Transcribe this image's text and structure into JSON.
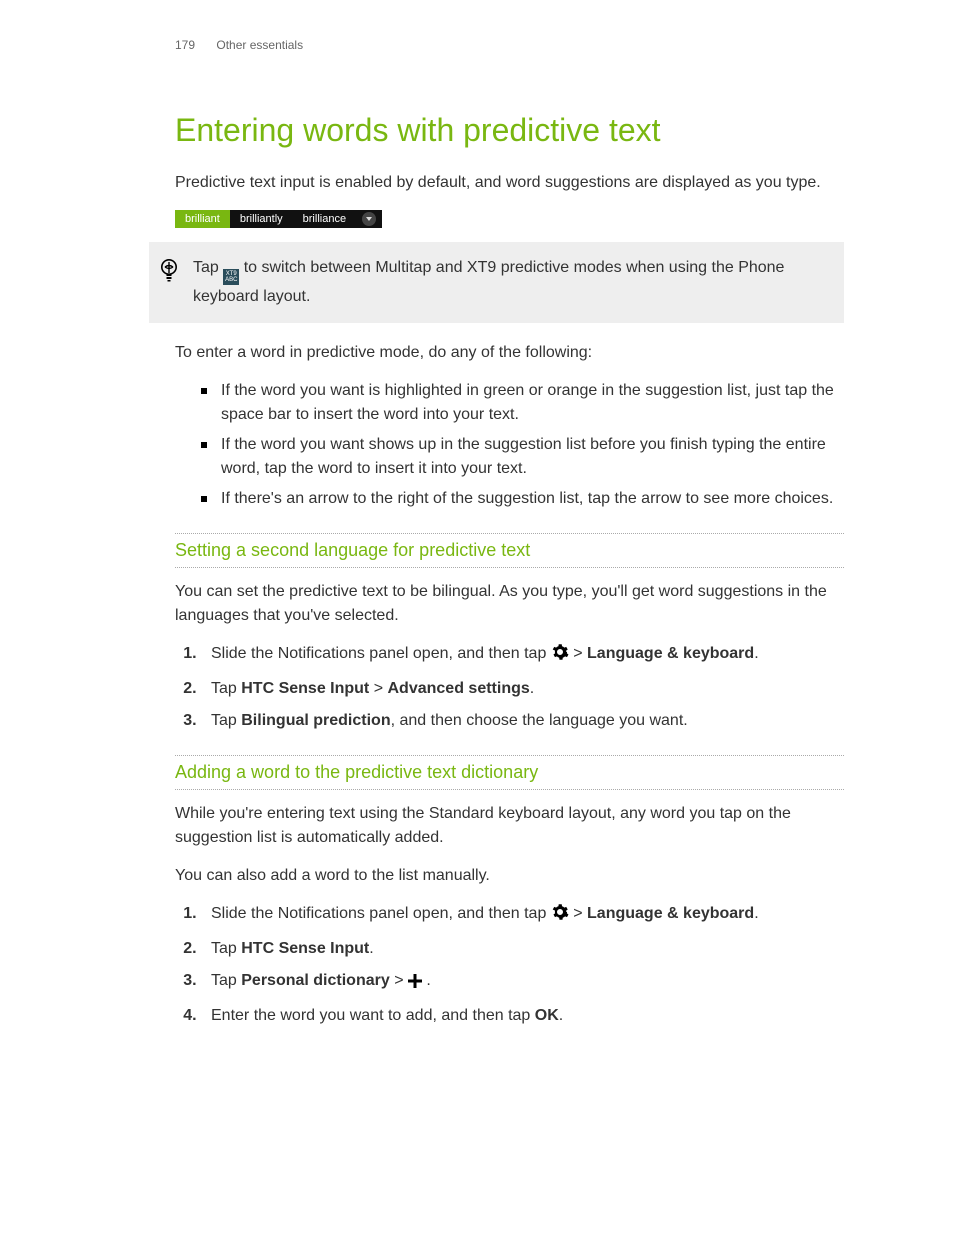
{
  "header": {
    "page_number": "179",
    "section": "Other essentials"
  },
  "title": "Entering words with predictive text",
  "intro": "Predictive text input is enabled by default, and word suggestions are displayed as you type.",
  "suggestions": {
    "highlighted": "brilliant",
    "items": [
      "brilliantly",
      "brilliance"
    ]
  },
  "tip": {
    "before": "Tap ",
    "after": " to switch between Multitap and XT9 predictive modes when using the Phone keyboard layout.",
    "chip_label": "XT9\nABC"
  },
  "lead": "To enter a word in predictive mode, do any of the following:",
  "bullets": [
    "If the word you want is highlighted in green or orange in the suggestion list, just tap the space bar to insert the word into your text.",
    "If the word you want shows up in the suggestion list before you finish typing the entire word, tap the word to insert it into your text.",
    "If there's an arrow to the right of the suggestion list, tap the arrow to see more choices."
  ],
  "sec1": {
    "heading": "Setting a second language for predictive text",
    "intro": "You can set the predictive text to be bilingual. As you type, you'll get word suggestions in the languages that you've selected.",
    "steps": {
      "s1a": "Slide the Notifications panel open, and then tap ",
      "s1b": " > ",
      "s1c": "Language & keyboard",
      "s1d": ".",
      "s2a": "Tap ",
      "s2b": "HTC Sense Input",
      "s2c": " > ",
      "s2d": "Advanced settings",
      "s2e": ".",
      "s3a": "Tap ",
      "s3b": "Bilingual prediction",
      "s3c": ", and then choose the language you want."
    }
  },
  "sec2": {
    "heading": "Adding a word to the predictive text dictionary",
    "p1": "While you're entering text using the Standard keyboard layout, any word you tap on the suggestion list is automatically added.",
    "p2": "You can also add a word to the list manually.",
    "steps": {
      "s1a": "Slide the Notifications panel open, and then tap ",
      "s1b": " > ",
      "s1c": "Language & keyboard",
      "s1d": ".",
      "s2a": "Tap ",
      "s2b": "HTC Sense Input",
      "s2c": ".",
      "s3a": "Tap ",
      "s3b": "Personal dictionary",
      "s3c": " > ",
      "s3d": " .",
      "s4a": "Enter the word you want to add, and then tap ",
      "s4b": "OK",
      "s4c": "."
    }
  }
}
